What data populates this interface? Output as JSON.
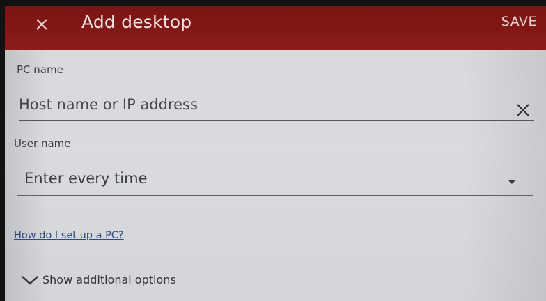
{
  "header": {
    "title": "Add desktop",
    "close_icon": "close-icon",
    "save_label": "SAVE",
    "color": "#831816"
  },
  "form": {
    "pc_name": {
      "label": "PC name",
      "placeholder": "Host name or IP address",
      "value": "",
      "clear_icon": "clear-icon"
    },
    "user_name": {
      "label": "User name",
      "selected": "Enter every time",
      "dropdown_icon": "dropdown-arrow-icon"
    },
    "help_link": "How do I set up a PC?",
    "more_options": {
      "label": "Show additional options",
      "icon": "chevron-down-icon"
    }
  }
}
